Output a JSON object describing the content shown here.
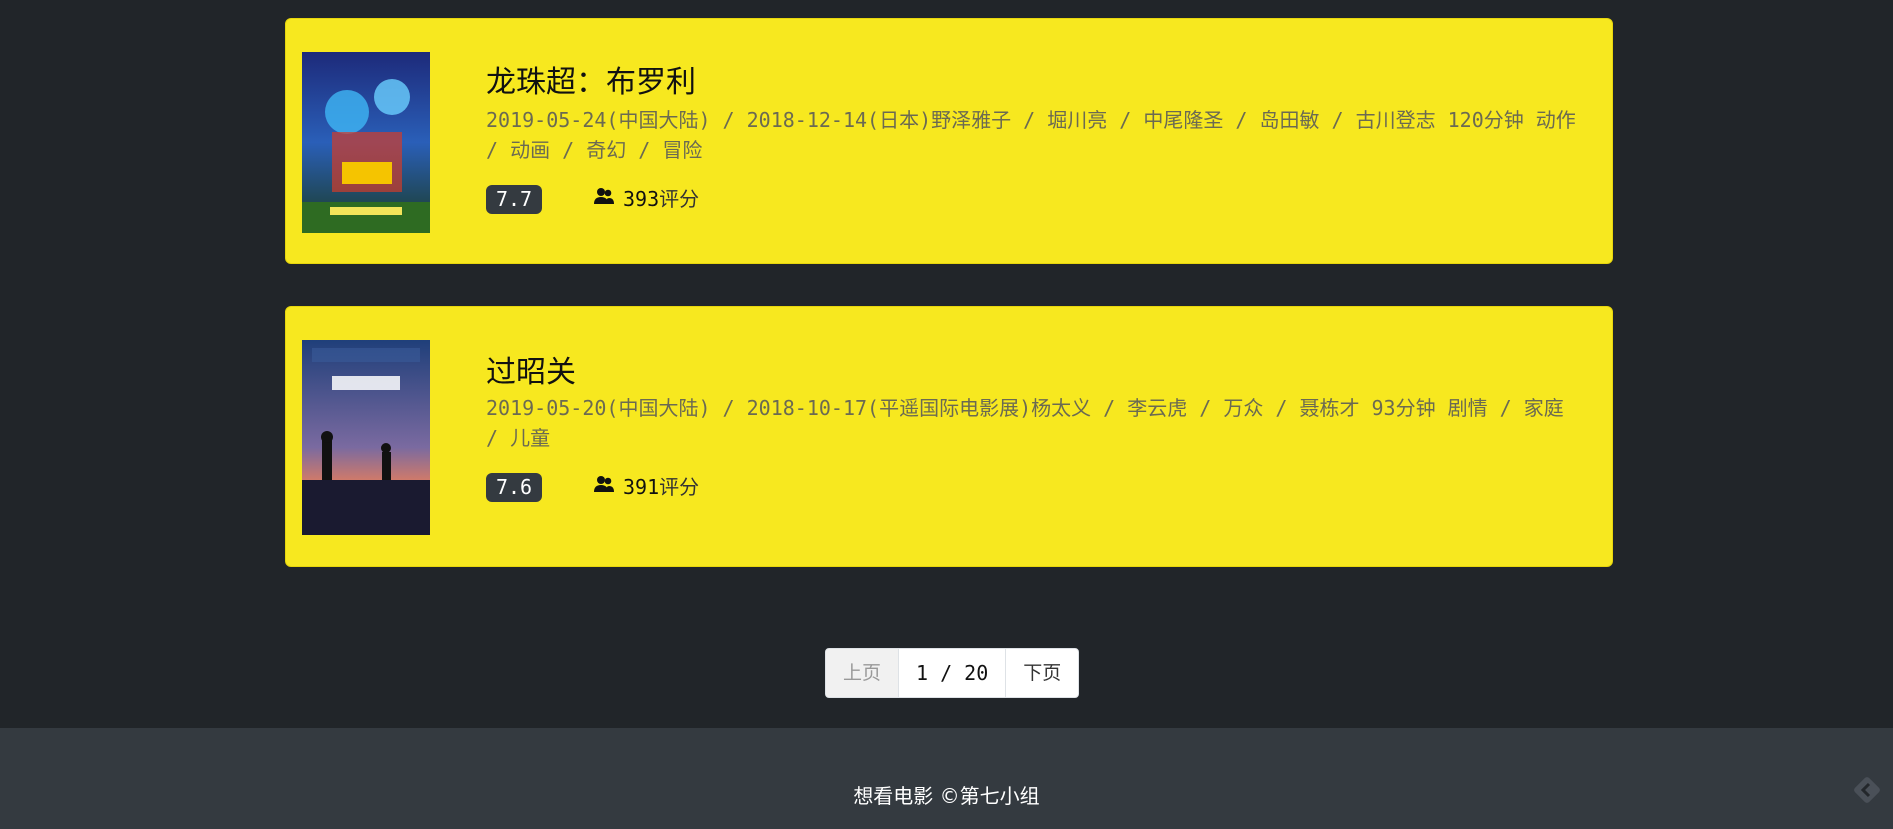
{
  "movies": [
    {
      "title": "龙珠超：布罗利",
      "meta": "2019-05-24(中国大陆) / 2018-12-14(日本)野泽雅子 / 堀川亮 / 中尾隆圣 / 岛田敏 / 古川登志 120分钟 动作 / 动画 / 奇幻 / 冒险",
      "rating": "7.7",
      "votes": "393",
      "votes_label": "评分",
      "poster_icon": "poster-image"
    },
    {
      "title": "过昭关",
      "meta": "2019-05-20(中国大陆) / 2018-10-17(平遥国际电影展)杨太义 / 李云虎 / 万众 / 聂栋才 93分钟 剧情 / 家庭 / 儿童",
      "rating": "7.6",
      "votes": "391",
      "votes_label": "评分",
      "poster_icon": "poster-image"
    }
  ],
  "pagination": {
    "prev_label": "上页",
    "page_info": "1 / 20",
    "next_label": "下页"
  },
  "footer": {
    "text": "想看电影 ©第七小组"
  },
  "colors": {
    "background": "#212529",
    "card": "#f7e81f",
    "badge": "#343a40",
    "footer": "#343a40"
  }
}
